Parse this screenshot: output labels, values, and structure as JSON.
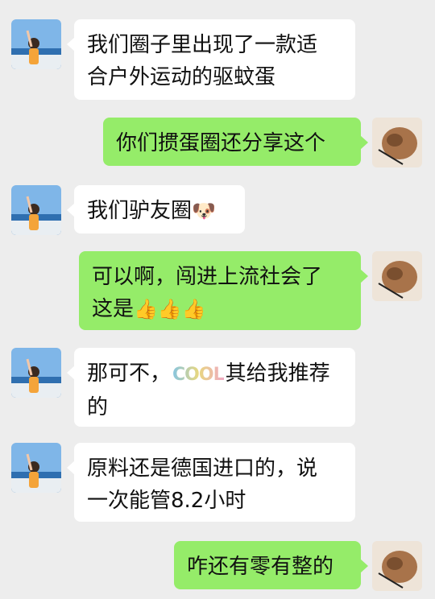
{
  "messages": [
    {
      "side": "left",
      "lines": [
        "我们圈子里出现了一款适",
        "合户外运动的驱蚊蛋"
      ]
    },
    {
      "side": "right",
      "lines": [
        "你们掼蛋圈还分享这个"
      ]
    },
    {
      "side": "left",
      "lines": [
        "我们驴友圈"
      ],
      "emoji": "🐶"
    },
    {
      "side": "right",
      "lines": [
        "可以啊，闯进上流社会了",
        "这是"
      ],
      "emoji": "👍👍👍"
    },
    {
      "side": "left",
      "lines": [
        "那可不，",
        "其给我推荐",
        "的"
      ],
      "sticker": "COOL"
    },
    {
      "side": "left",
      "lines": [
        "原料还是德国进口的，说",
        "一次能管8.2小时"
      ]
    },
    {
      "side": "right",
      "lines": [
        "咋还有零有整的"
      ]
    }
  ]
}
